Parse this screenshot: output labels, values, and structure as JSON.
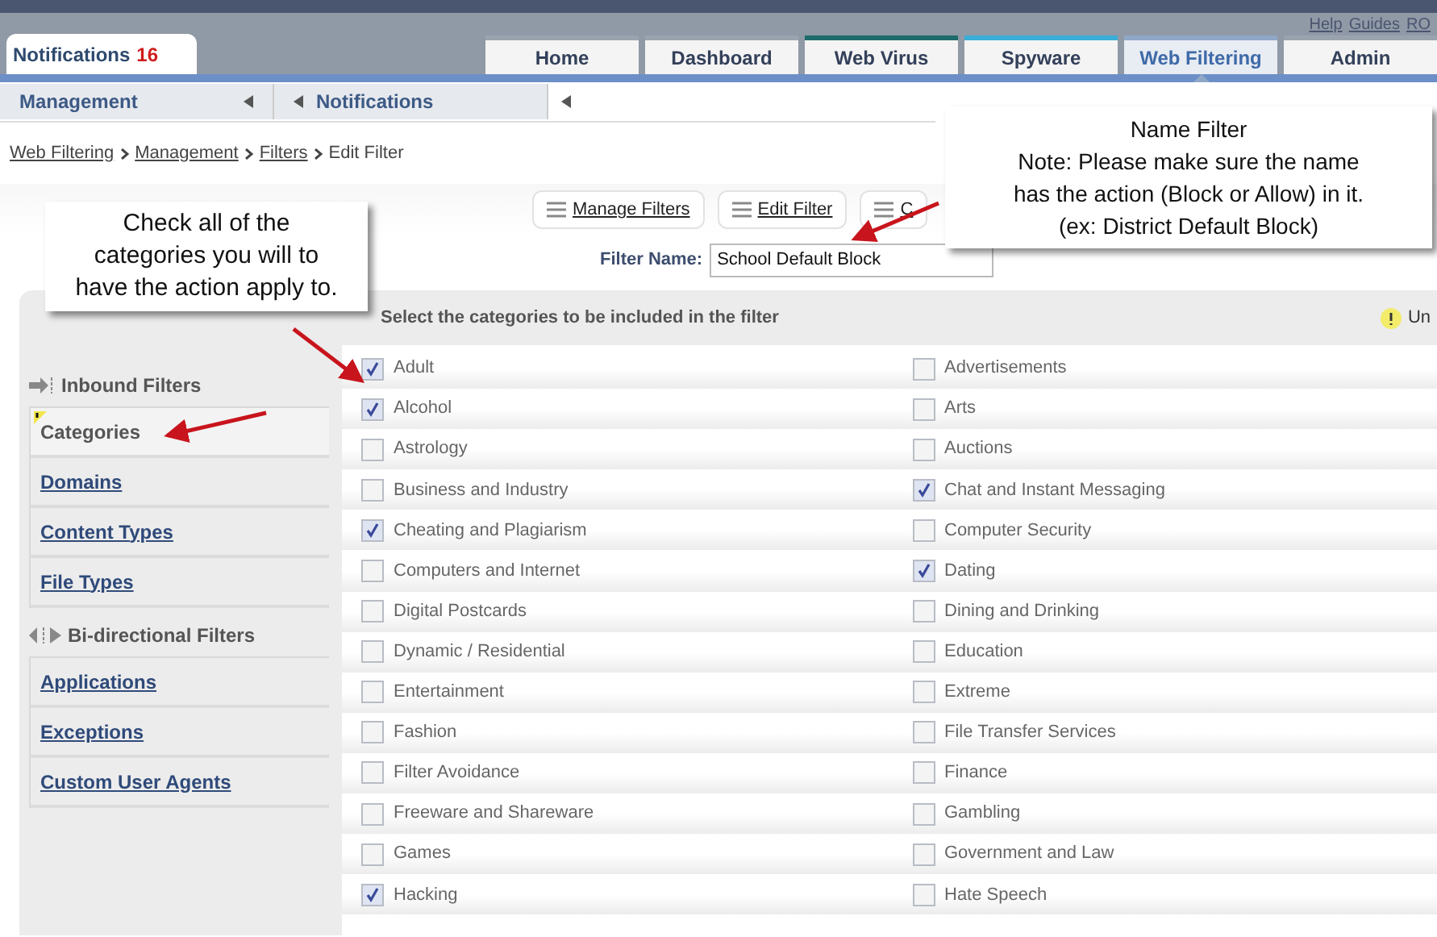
{
  "utility_links": [
    "Help",
    "Guides",
    "RO"
  ],
  "notifications_tab": {
    "label": "Notifications",
    "count": "16"
  },
  "tabs": [
    {
      "label": "Home",
      "selected": false,
      "color": "#9aa3ad"
    },
    {
      "label": "Dashboard",
      "selected": false,
      "color": "#9aa3ad"
    },
    {
      "label": "Web Virus",
      "selected": false,
      "color": "#1d6b6b"
    },
    {
      "label": "Spyware",
      "selected": false,
      "color": "#3aaed8"
    },
    {
      "label": "Web Filtering",
      "selected": true,
      "color": "#8fa8c8"
    },
    {
      "label": "Admin",
      "selected": false,
      "color": "#9aa3ad"
    }
  ],
  "subnav": [
    "Management",
    "Notifications"
  ],
  "breadcrumb": [
    "Web Filtering",
    "Management",
    "Filters",
    "Edit Filter"
  ],
  "toolbar": [
    "Manage Filters",
    "Edit Filter",
    "C"
  ],
  "filter_name": {
    "label": "Filter Name:",
    "value": "School Default Block"
  },
  "sidebar": [
    {
      "heading": "Inbound Filters",
      "kind": "inbound",
      "items": [
        {
          "label": "Categories",
          "selected": true
        },
        {
          "label": "Domains",
          "selected": false
        },
        {
          "label": "Content Types",
          "selected": false
        },
        {
          "label": "File Types",
          "selected": false
        }
      ]
    },
    {
      "heading": "Bi-directional Filters",
      "kind": "bidirectional",
      "items": [
        {
          "label": "Applications",
          "selected": false
        },
        {
          "label": "Exceptions",
          "selected": false
        },
        {
          "label": "Custom User Agents",
          "selected": false
        }
      ]
    }
  ],
  "panel": {
    "title": "Select the categories to be included in the filter",
    "notice": "Un"
  },
  "categories": [
    {
      "label": "Adult",
      "checked": true
    },
    {
      "label": "Advertisements",
      "checked": false
    },
    {
      "label": "Alcohol",
      "checked": true
    },
    {
      "label": "Arts",
      "checked": false
    },
    {
      "label": "Astrology",
      "checked": false
    },
    {
      "label": "Auctions",
      "checked": false
    },
    {
      "label": "Business and Industry",
      "checked": false
    },
    {
      "label": "Chat and Instant Messaging",
      "checked": true
    },
    {
      "label": "Cheating and Plagiarism",
      "checked": true
    },
    {
      "label": "Computer Security",
      "checked": false
    },
    {
      "label": "Computers and Internet",
      "checked": false
    },
    {
      "label": "Dating",
      "checked": true
    },
    {
      "label": "Digital Postcards",
      "checked": false
    },
    {
      "label": "Dining and Drinking",
      "checked": false
    },
    {
      "label": "Dynamic / Residential",
      "checked": false
    },
    {
      "label": "Education",
      "checked": false
    },
    {
      "label": "Entertainment",
      "checked": false
    },
    {
      "label": "Extreme",
      "checked": false
    },
    {
      "label": "Fashion",
      "checked": false
    },
    {
      "label": "File Transfer Services",
      "checked": false
    },
    {
      "label": "Filter Avoidance",
      "checked": false
    },
    {
      "label": "Finance",
      "checked": false
    },
    {
      "label": "Freeware and Shareware",
      "checked": false
    },
    {
      "label": "Gambling",
      "checked": false
    },
    {
      "label": "Games",
      "checked": false
    },
    {
      "label": "Government and Law",
      "checked": false
    },
    {
      "label": "Hacking",
      "checked": true
    },
    {
      "label": "Hate Speech",
      "checked": false
    }
  ],
  "callouts": [
    {
      "lines": [
        "Check all of the",
        "categories you will to",
        "have the action apply to."
      ]
    },
    {
      "lines": [
        "Name Filter",
        "Note: Please make sure the name",
        "has the action (Block or Allow) in it.",
        "(ex: District Default Block)"
      ]
    }
  ]
}
